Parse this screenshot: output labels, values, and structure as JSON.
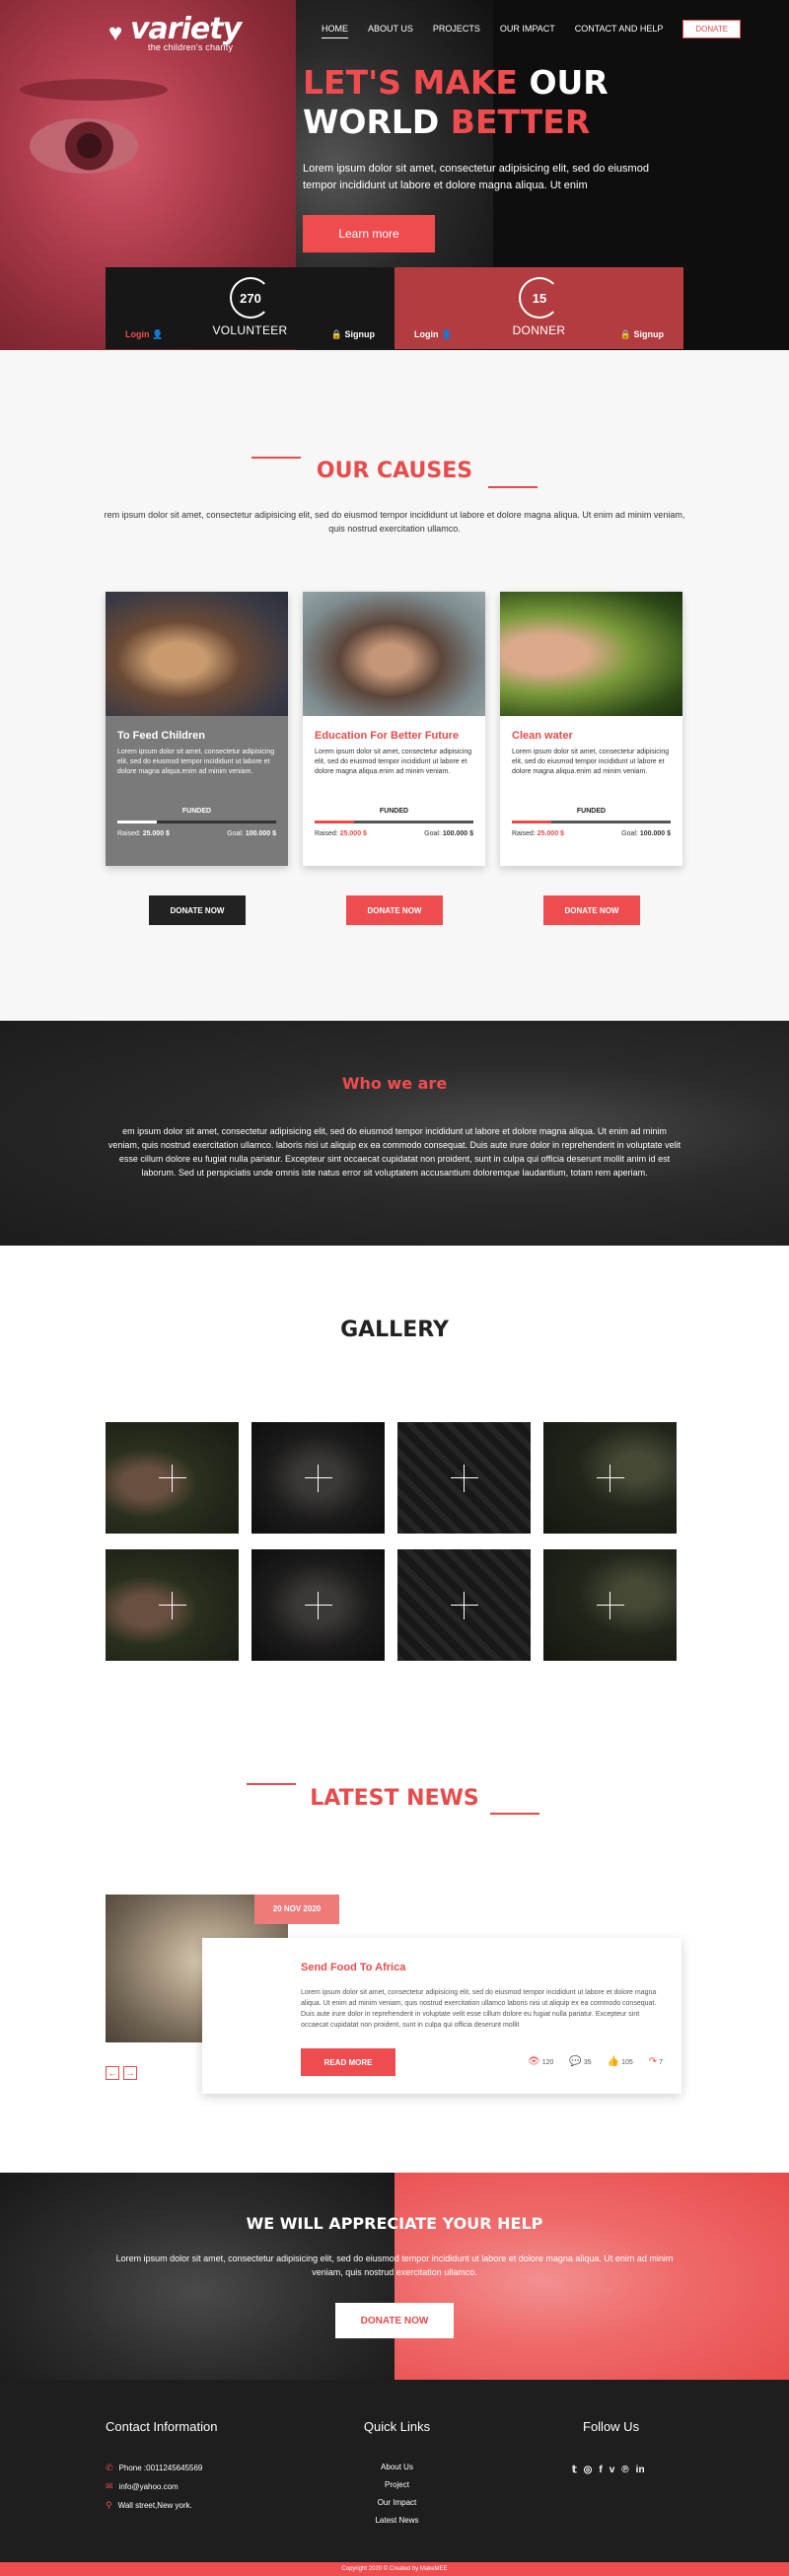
{
  "header": {
    "logo_word": "variety",
    "logo_sub": "the children's charity",
    "nav": [
      "HOME",
      "ABOUT US",
      "PROJECTS",
      "OUR IMPACT",
      "CONTACT AND HELP"
    ],
    "donate": "DONATE"
  },
  "hero": {
    "line1_red": "LET'S MAKE",
    "line1_white": "OUR",
    "line2_white": "WORLD",
    "line2_red": "BETTER",
    "text": "Lorem ipsum dolor sit amet, consectetur adipisicing elit, sed do eiusmod tempor incididunt ut labore et dolore magna aliqua. Ut enim",
    "cta": "Learn more",
    "volunteer": {
      "count": "270",
      "label": "VOLUNTEER",
      "login": "Login",
      "signup": "Signup"
    },
    "donner": {
      "count": "15",
      "label": "DONNER",
      "login": "Login",
      "signup": "Signup"
    }
  },
  "causes": {
    "title": "OUR CAUSES",
    "desc": "rem ipsum dolor sit amet, consectetur adipisicing elit, sed do eiusmod tempor incididunt ut labore et dolore magna aliqua. Ut enim ad minim veniam, quis nostrud exercitation ullamco.",
    "cards": [
      {
        "title": "To Feed Children",
        "text": "Lorem ipsum dolor sit amet, consectetur adipisicing elit, sed do eiusmod tempor incididunt ut labore et dolore magna aliqua.enim ad minim veniam.",
        "funded": "FUNDED",
        "progress": 0.25,
        "raised_label": "Raised:",
        "raised": "25.000 $",
        "goal_label": "Goal:",
        "goal": "100.000 $",
        "button": "DONATE NOW"
      },
      {
        "title": "Education For Better Future",
        "text": "Lorem ipsum dolor sit amet, consectetur adipisicing elit, sed do eiusmod tempor incididunt ut labore et dolore magna aliqua.enim ad minim veniam.",
        "funded": "FUNDED",
        "progress": 0.25,
        "raised_label": "Raised:",
        "raised": "25.000 $",
        "goal_label": "Goal:",
        "goal": "100.000 $",
        "button": "DONATE NOW"
      },
      {
        "title": "Clean water",
        "text": "Lorem ipsum dolor sit amet, consectetur adipisicing elit, sed do eiusmod tempor incididunt ut labore et dolore magna aliqua.enim ad minim veniam.",
        "funded": "FUNDED",
        "progress": 0.25,
        "raised_label": "Raised:",
        "raised": "25.000 $",
        "goal_label": "Goal:",
        "goal": "100.000 $",
        "button": "DONATE NOW"
      }
    ]
  },
  "who": {
    "title": "Who we are",
    "text": "em ipsum dolor sit amet, consectetur adipisicing elit, sed do eiusmod tempor incididunt ut labore et dolore magna aliqua. Ut enim ad minim veniam, quis nostrud exercitation ullamco. laboris nisi ut aliquip ex ea commodo consequat. Duis aute irure dolor in reprehenderit in voluptate velit esse cillum dolore eu fugiat nulla pariatur. Excepteur sint occaecat cupidatat non proident, sunt in culpa qui officia deserunt mollit anim id est laborum. Sed ut perspiciatis unde omnis iste natus error sit voluptatem accusantium doloremque laudantium, totam rem aperiam."
  },
  "gallery": {
    "title": "GALLERY"
  },
  "news": {
    "title": "LATEST NEWS",
    "date": "20 NOV 2020",
    "post_title": "Send Food To Africa",
    "text": "Lorem ipsum dolor sit amet, consectetur adipisicing elit, sed do eiusmod tempor incididunt ut labore et dolore magna aliqua. Ut enim ad minim veniam, quis nostrud exercitation ullamco laboris nisi ut aliquip ex ea commodo consequat. Duis aute irure dolor in reprehenderit in voluptate velit esse cillum dolore eu fugiat nulla pariatur. Excepteur sint occaecat cupidatat non proident, sunt in culpa qui officia deserunt mollit",
    "read_more": "READ MORE",
    "views": "120",
    "comments": "35",
    "likes": "105",
    "shares": "7"
  },
  "appreciate": {
    "title": "WE WILL APPRECIATE YOUR HELP",
    "text": "Lorem ipsum dolor sit amet, consectetur adipisicing elit, sed do eiusmod tempor incididunt ut labore et dolore magna aliqua. Ut enim ad minim veniam, quis nostrud exercitation ullamco.",
    "button": "DONATE NOW"
  },
  "footer": {
    "contact_title": "Contact Information",
    "phone": "Phone :0011245645569",
    "email": "info@yahoo.com",
    "address": "Wall street,New york.",
    "links_title": "Quick Links",
    "links": [
      "About Us",
      "Project",
      "Our Impact",
      "Latest News"
    ],
    "follow_title": "Follow Us",
    "copyright": "Copyright 2020 © Created by MakeMEE"
  },
  "colors": {
    "accent": "#ef4c50",
    "dark": "#1e1e1e"
  }
}
